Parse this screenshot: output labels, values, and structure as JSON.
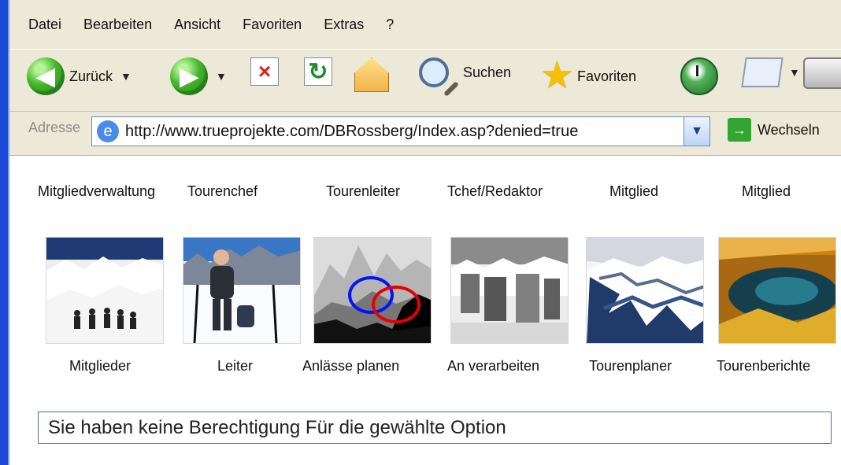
{
  "menu": [
    "Datei",
    "Bearbeiten",
    "Ansicht",
    "Favoriten",
    "Extras",
    "?"
  ],
  "toolbar": {
    "back_label": "Zurück",
    "search_label": "Suchen",
    "favorites_label": "Favoriten"
  },
  "address": {
    "label": "Adresse",
    "url": "http://www.trueprojekte.com/DBRossberg/Index.asp?denied=true",
    "go_label": "Wechseln"
  },
  "columns": [
    "Mitgliedverwaltung",
    "Tourenchef",
    "Tourenleiter",
    "Tchef/Redaktor",
    "Mitglied",
    "Mitglied"
  ],
  "tiles": [
    "Mitglieder",
    "Leiter",
    "Anlässe planen",
    "An verarbeiten",
    "Tourenplaner",
    "Tourenberichte"
  ],
  "status": "Sie haben keine Berechtigung Für die gewählte Option",
  "colors": {
    "xp_blue": "#1b49d8",
    "chrome_bg": "#ece9d8",
    "highlight_red": "#e60000",
    "highlight_blue": "#0014ff"
  }
}
